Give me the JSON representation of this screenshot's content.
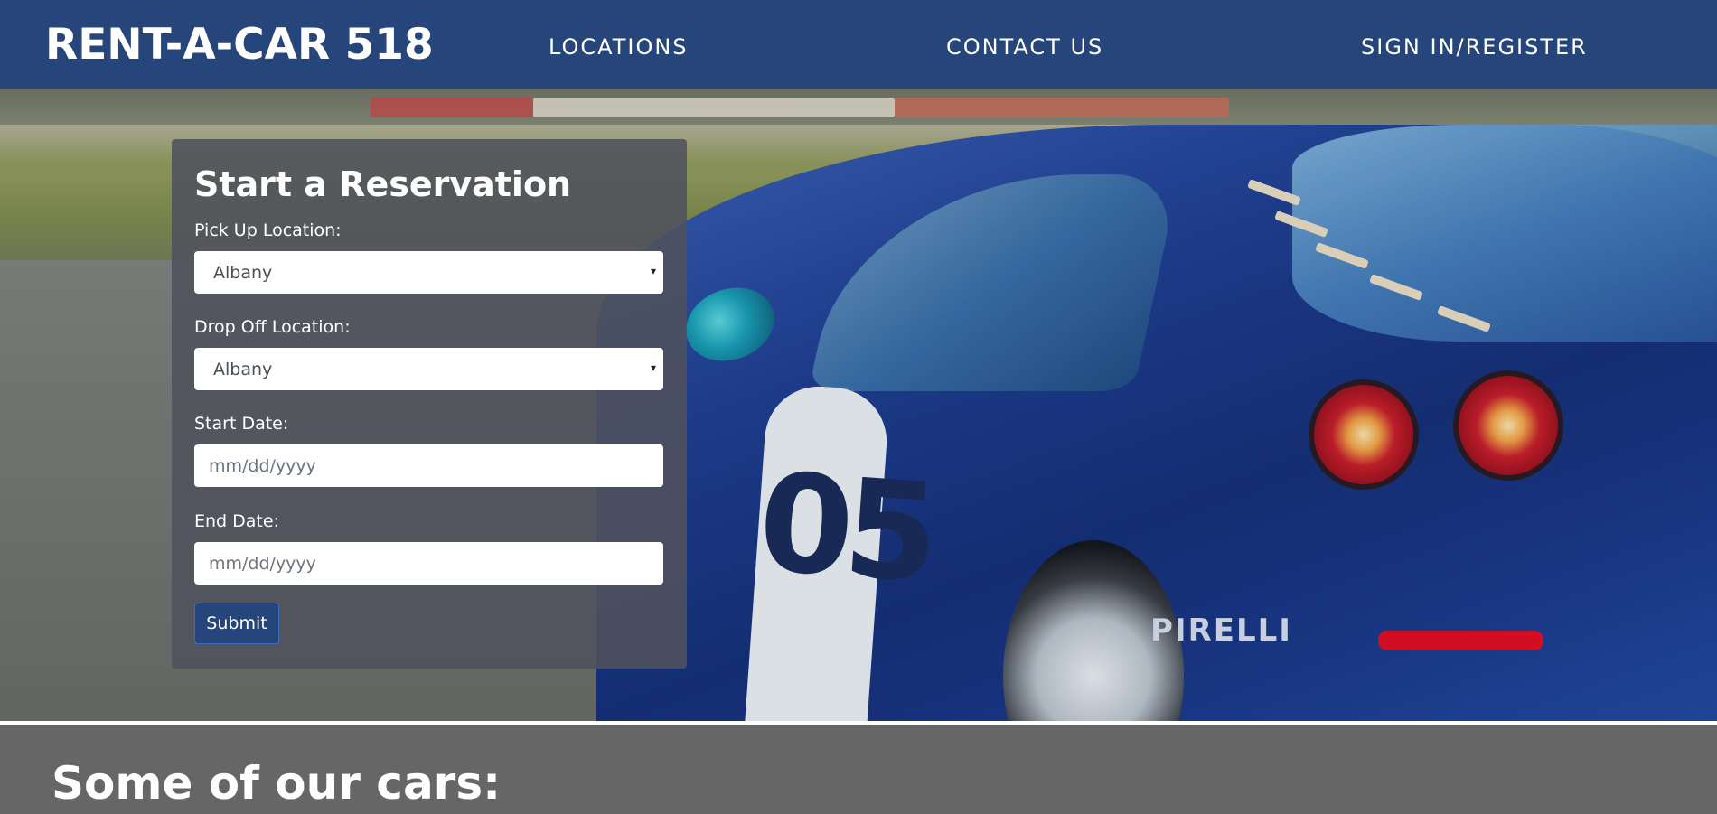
{
  "navbar": {
    "brand": "RENT-A-CAR 518",
    "links": [
      {
        "label": "LOCATIONS"
      },
      {
        "label": "CONTACT US"
      },
      {
        "label": "SIGN IN/REGISTER"
      }
    ],
    "background_color": "#26457b"
  },
  "hero": {
    "decal_number": "05",
    "decal_brand": "PIRELLI"
  },
  "reservation": {
    "title": "Start a Reservation",
    "pickup": {
      "label": "Pick Up Location:",
      "value": "Albany"
    },
    "dropoff": {
      "label": "Drop Off Location:",
      "value": "Albany"
    },
    "start_date": {
      "label": "Start Date:",
      "placeholder": "mm/dd/yyyy"
    },
    "end_date": {
      "label": "End Date:",
      "placeholder": "mm/dd/yyyy"
    },
    "submit_label": "Submit"
  },
  "cars_section": {
    "heading": "Some of our cars:"
  },
  "icons": {
    "select_arrow": "▾"
  }
}
